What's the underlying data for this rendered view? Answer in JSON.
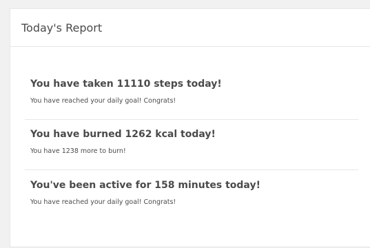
{
  "report": {
    "title": "Today's Report",
    "items": [
      {
        "headline": "You have taken 11110 steps today!",
        "detail": "You have reached your daily goal! Congrats!"
      },
      {
        "headline": "You have burned 1262 kcal today!",
        "detail": "You have 1238 more to burn!"
      },
      {
        "headline": "You've been active for 158 minutes today!",
        "detail": "You have reached your daily goal! Congrats!"
      }
    ]
  }
}
